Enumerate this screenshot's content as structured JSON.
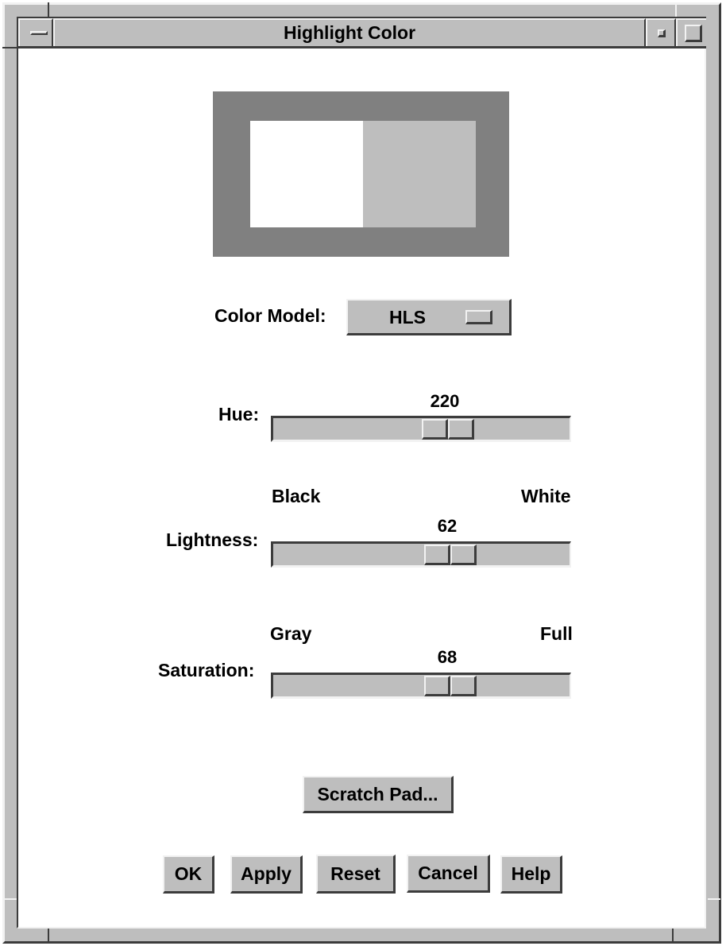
{
  "window": {
    "title": "Highlight Color",
    "buttons": [
      "window-menu",
      "minimize",
      "maximize"
    ]
  },
  "preview": {
    "old_color": "#ffffff",
    "new_color": "#bebebe",
    "border_color": "#808080"
  },
  "color_model": {
    "label": "Color Model:",
    "selected": "HLS"
  },
  "sliders": {
    "hue": {
      "label": "Hue:",
      "value": "220",
      "min_label": "",
      "max_label": "",
      "fraction": 0.61
    },
    "lightness": {
      "label": "Lightness:",
      "value": "62",
      "min_label": "Black",
      "max_label": "White",
      "fraction": 0.62
    },
    "saturation": {
      "label": "Saturation:",
      "value": "68",
      "min_label": "Gray",
      "max_label": "Full",
      "fraction": 0.62
    }
  },
  "scratch_pad": {
    "label": "Scratch Pad..."
  },
  "actions": {
    "ok": "OK",
    "apply": "Apply",
    "reset": "Reset",
    "cancel": "Cancel",
    "help": "Help"
  }
}
